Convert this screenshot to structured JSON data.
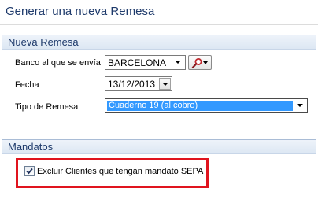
{
  "window": {
    "title": "Generar una nueva Remesa"
  },
  "nueva_remesa": {
    "header": "Nueva Remesa",
    "banco_label": "Banco al que se envía",
    "banco_value": "BARCELONA",
    "search_icon": "magnifier-icon",
    "fecha_label": "Fecha",
    "fecha_value": "13/12/2013",
    "tipo_label": "Tipo de Remesa",
    "tipo_value": "Cuaderno 19 (al cobro)"
  },
  "mandatos": {
    "header": "Mandatos",
    "excluir_label": "Excluir Clientes que tengan mandato SEPA",
    "excluir_checked": true
  },
  "colors": {
    "header_text": "#1e3a6b",
    "selection": "#3399ff",
    "highlight_border": "#e0141e"
  }
}
